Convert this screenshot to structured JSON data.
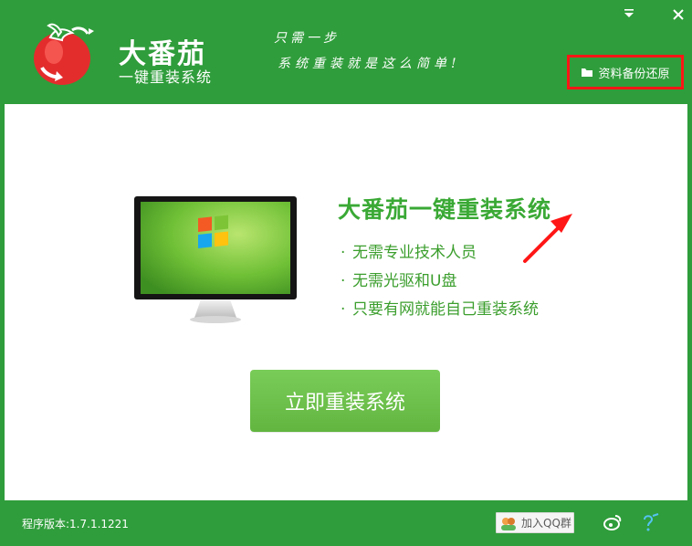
{
  "header": {
    "brand_title": "大番茄",
    "brand_subtitle": "一键重装系统",
    "slogan_line1": "只需一步",
    "slogan_line2": "系统重装就是这么简单!",
    "backup_label": "资料备份还原",
    "icons": [
      "tomato-logo-icon",
      "folder-icon",
      "menu-arrow-icon",
      "close-icon"
    ]
  },
  "main": {
    "title": "大番茄一键重装系统",
    "features": [
      "无需专业技术人员",
      "无需光驱和U盘",
      "只要有网就能自己重装系统"
    ],
    "install_label": "立即重装系统"
  },
  "footer": {
    "version": "程序版本:1.7.1.1221",
    "qq_label": "加入QQ群",
    "icons": [
      "weibo-icon",
      "help-icon"
    ]
  },
  "colors": {
    "brand_green": "#2f9d3b",
    "text_green": "#3aa935",
    "highlight_red": "#ff1616"
  }
}
